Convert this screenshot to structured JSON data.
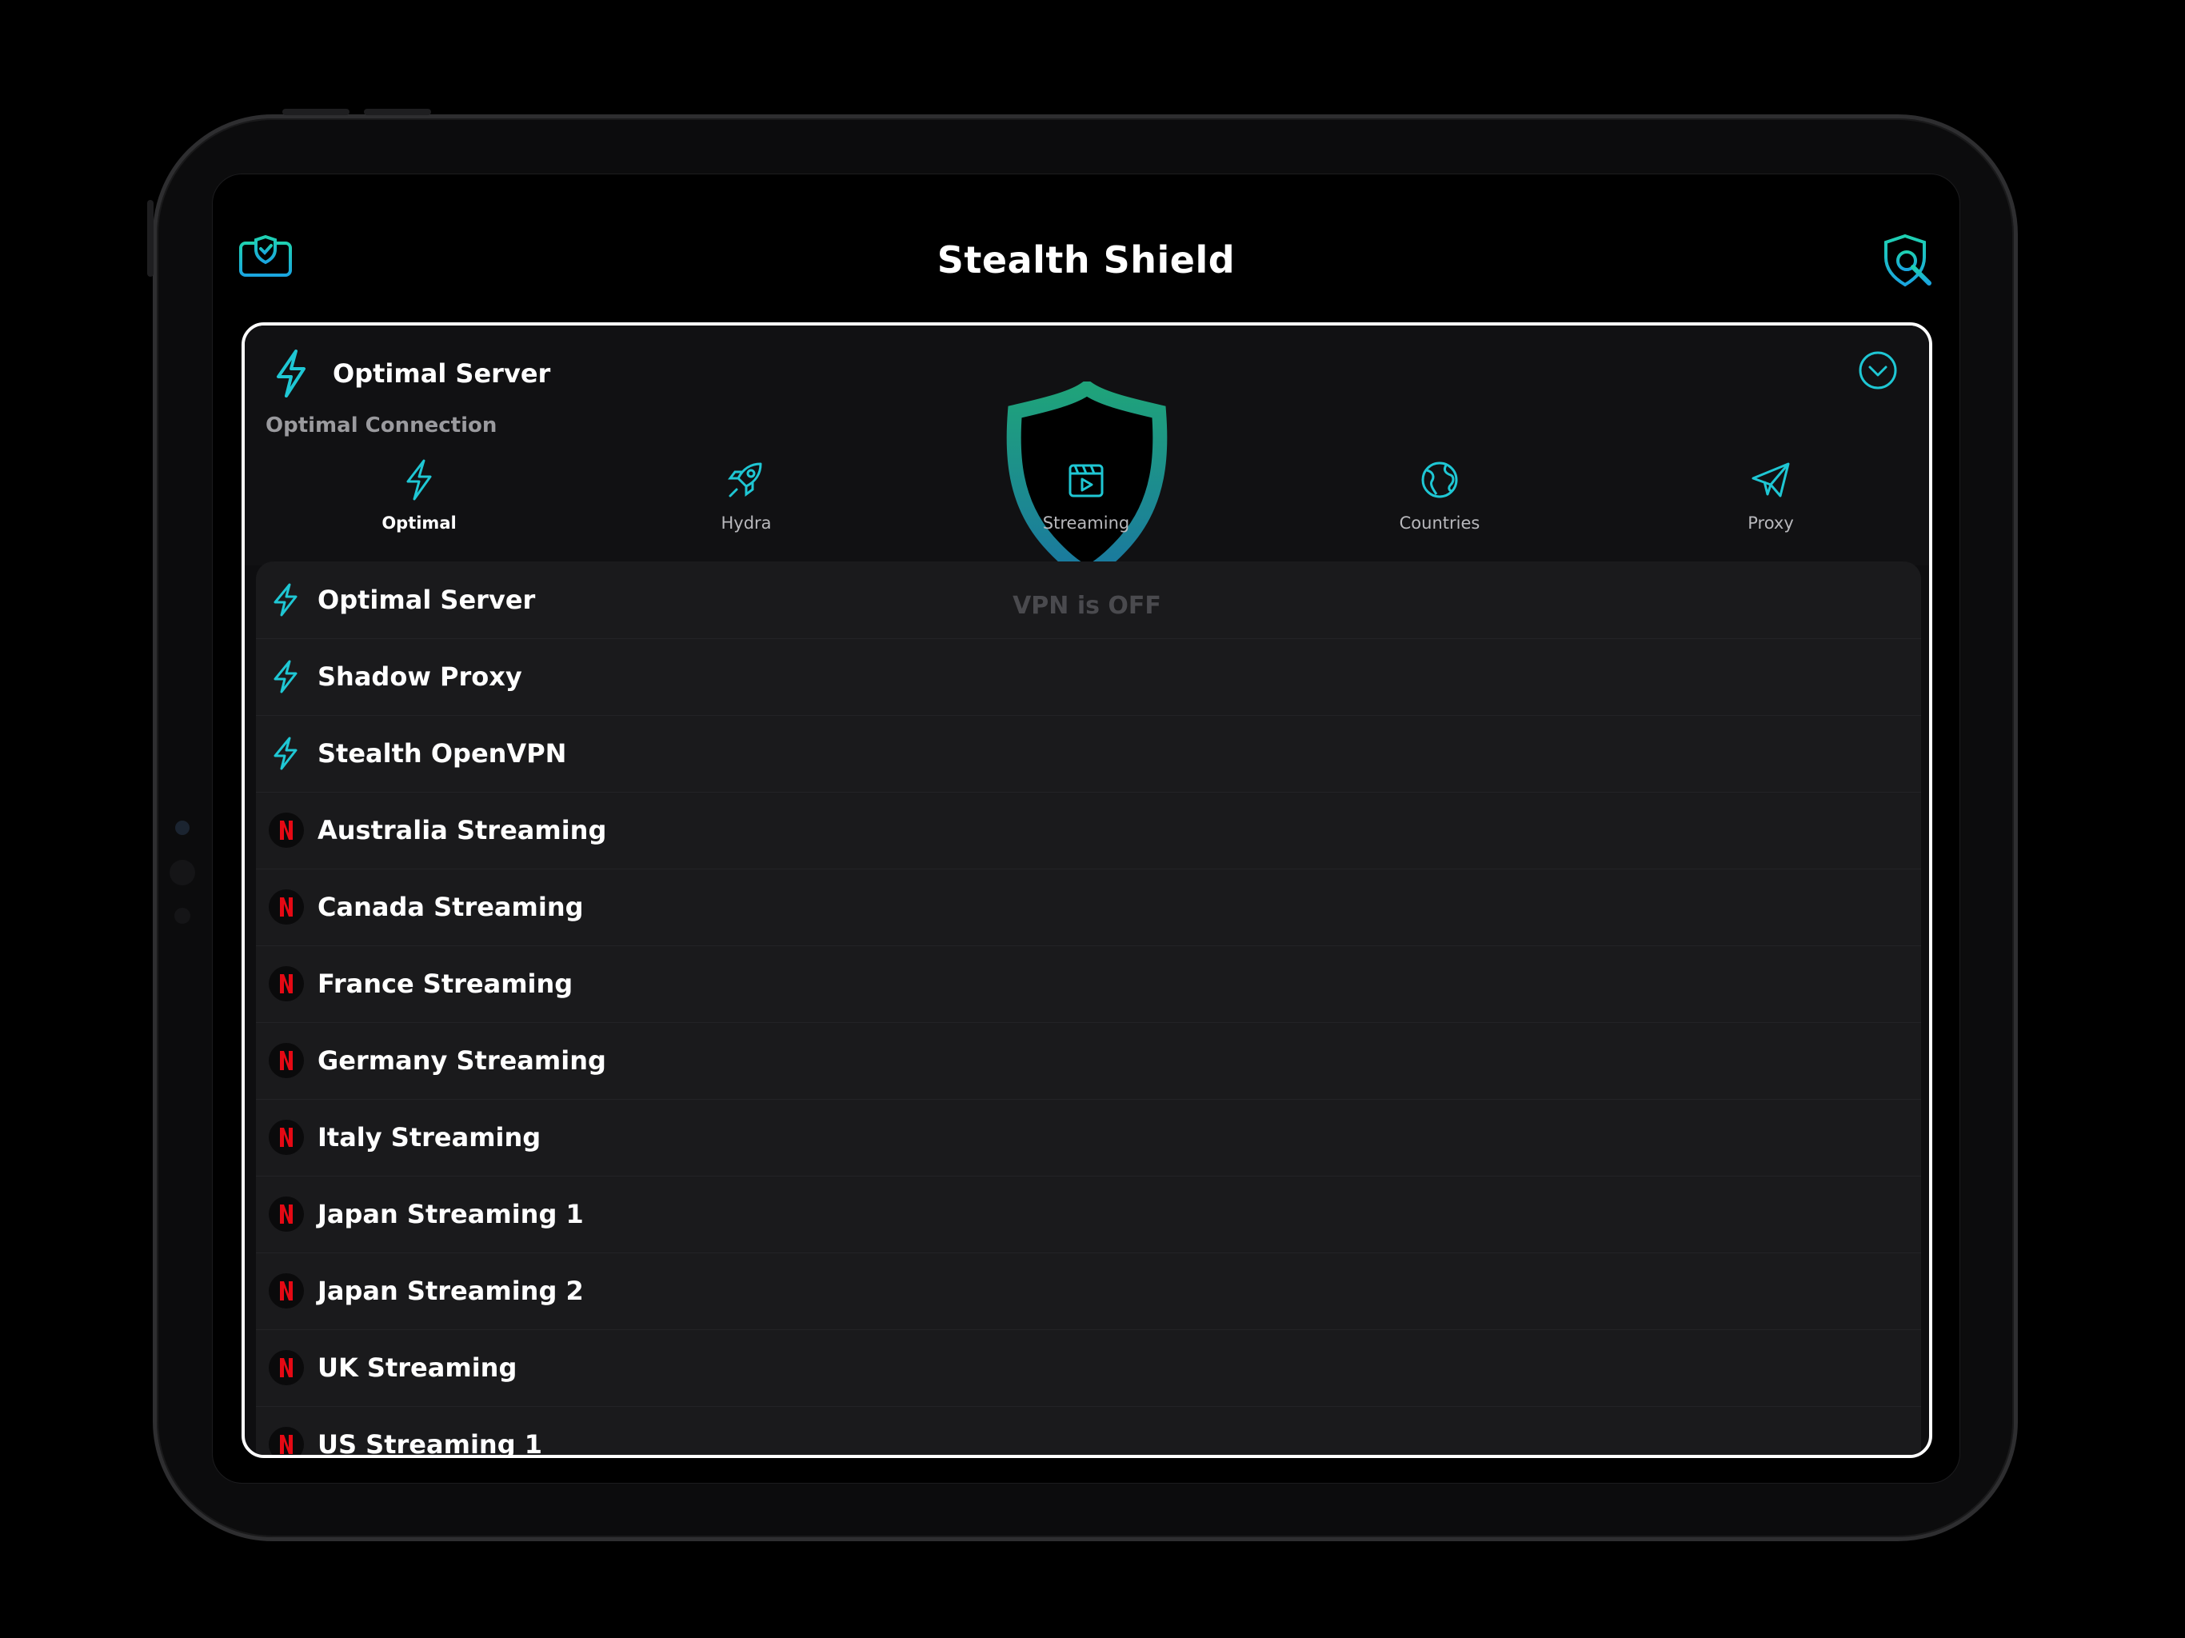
{
  "app": {
    "title": "Stealth Shield",
    "icons": {
      "left": "monitor-shield-icon",
      "right": "shield-settings-icon"
    }
  },
  "selected": {
    "label": "Optimal Server",
    "icon": "bolt-icon",
    "subtitle": "Optimal Connection",
    "collapse_icon": "chevron-down-icon"
  },
  "tabs": [
    {
      "label": "Optimal",
      "icon": "bolt-icon",
      "active": true
    },
    {
      "label": "Hydra",
      "icon": "rocket-icon"
    },
    {
      "label": "Streaming",
      "icon": "film-icon"
    },
    {
      "label": "Countries",
      "icon": "globe-icon"
    },
    {
      "label": "Proxy",
      "icon": "paper-plane-icon"
    }
  ],
  "status": {
    "text": "VPN is OFF"
  },
  "servers": [
    {
      "name": "Optimal Server",
      "icon": "bolt"
    },
    {
      "name": "Shadow Proxy",
      "icon": "bolt"
    },
    {
      "name": "Stealth OpenVPN",
      "icon": "bolt"
    },
    {
      "name": "Australia Streaming",
      "icon": "netflix"
    },
    {
      "name": "Canada Streaming",
      "icon": "netflix"
    },
    {
      "name": "France Streaming",
      "icon": "netflix"
    },
    {
      "name": "Germany Streaming",
      "icon": "netflix"
    },
    {
      "name": "Italy Streaming",
      "icon": "netflix"
    },
    {
      "name": "Japan Streaming 1",
      "icon": "netflix"
    },
    {
      "name": "Japan Streaming 2",
      "icon": "netflix"
    },
    {
      "name": "UK Streaming",
      "icon": "netflix"
    },
    {
      "name": "US Streaming 1",
      "icon": "netflix"
    }
  ],
  "colors": {
    "accent": "#1fc7d4",
    "accent_green": "#1fa37a",
    "netflix": "#e50914"
  }
}
